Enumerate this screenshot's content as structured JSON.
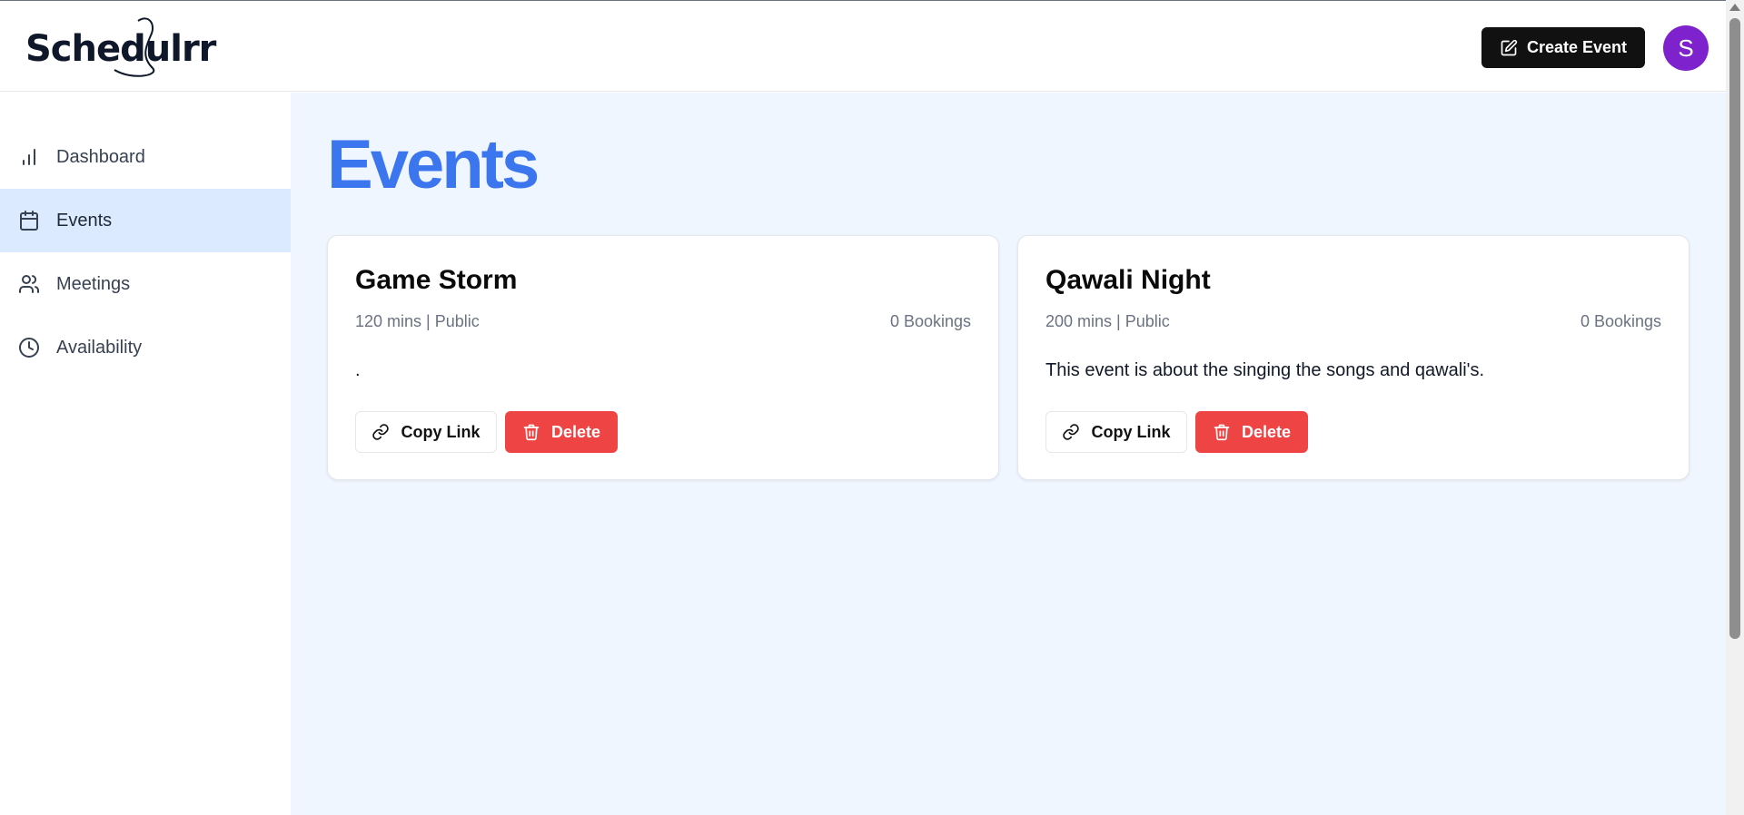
{
  "header": {
    "logo_text": "Schedulrr",
    "create_button_label": "Create Event",
    "avatar_initial": "S"
  },
  "sidebar": {
    "items": [
      {
        "label": "Dashboard",
        "icon": "bar-chart-icon",
        "active": false
      },
      {
        "label": "Events",
        "icon": "calendar-icon",
        "active": true
      },
      {
        "label": "Meetings",
        "icon": "users-icon",
        "active": false
      },
      {
        "label": "Availability",
        "icon": "clock-icon",
        "active": false
      }
    ]
  },
  "main": {
    "title": "Events",
    "events": [
      {
        "title": "Game Storm",
        "meta": "120 mins | Public",
        "bookings": "0 Bookings",
        "description": ".",
        "copy_label": "Copy Link",
        "delete_label": "Delete"
      },
      {
        "title": "Qawali Night",
        "meta": "200 mins | Public",
        "bookings": "0 Bookings",
        "description": "This event is about the singing the songs and qawali's.",
        "copy_label": "Copy Link",
        "delete_label": "Delete"
      }
    ]
  },
  "colors": {
    "accent": "#3b76ee",
    "active_nav": "#dbeafe",
    "delete": "#ef4444",
    "avatar": "#7e22ce",
    "main_bg": "#eff6ff"
  }
}
